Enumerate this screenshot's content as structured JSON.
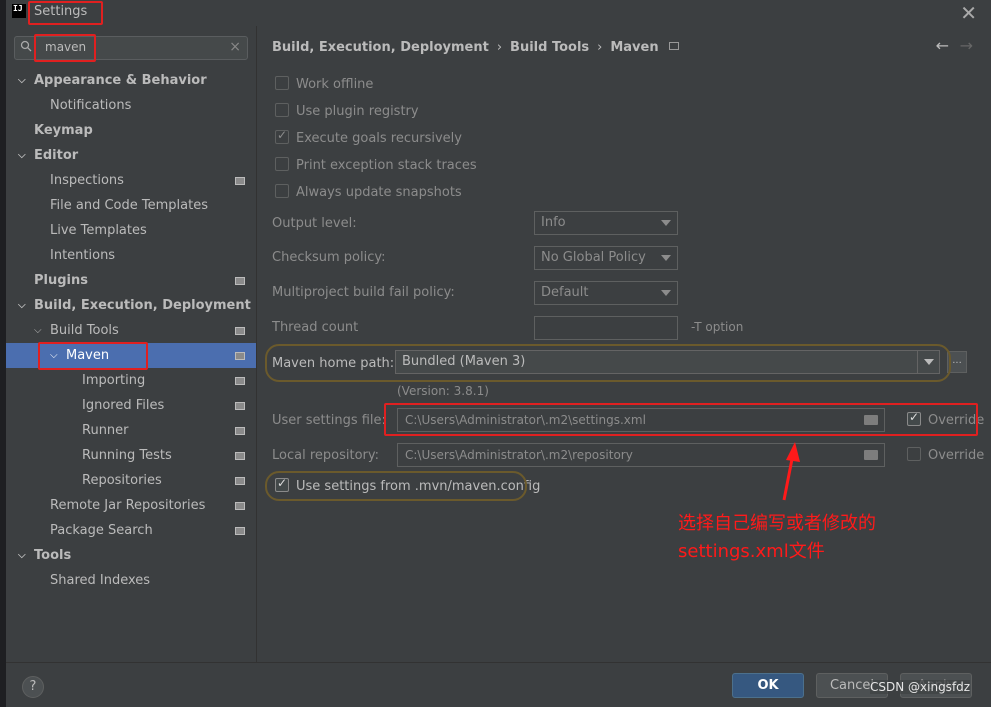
{
  "window": {
    "title": "Settings",
    "logo_text": "IJ"
  },
  "search": {
    "value": "maven"
  },
  "sidebar": {
    "items": [
      {
        "label": "Appearance & Behavior",
        "indent": 0,
        "bold": true,
        "arrow": "down"
      },
      {
        "label": "Notifications",
        "indent": 1,
        "bold": false
      },
      {
        "label": "Keymap",
        "indent": 0,
        "bold": true
      },
      {
        "label": "Editor",
        "indent": 0,
        "bold": true,
        "arrow": "down"
      },
      {
        "label": "Inspections",
        "indent": 1,
        "bold": false,
        "page_icon": true
      },
      {
        "label": "File and Code Templates",
        "indent": 1,
        "bold": false
      },
      {
        "label": "Live Templates",
        "indent": 1,
        "bold": false
      },
      {
        "label": "Intentions",
        "indent": 1,
        "bold": false
      },
      {
        "label": "Plugins",
        "indent": 0,
        "bold": true,
        "page_icon": true
      },
      {
        "label": "Build, Execution, Deployment",
        "indent": 0,
        "bold": true,
        "arrow": "down"
      },
      {
        "label": "Build Tools",
        "indent": 1,
        "bold": false,
        "arrow": "down",
        "page_icon": true
      },
      {
        "label": "Maven",
        "indent": 2,
        "bold": false,
        "arrow": "down",
        "page_icon": true,
        "selected": true
      },
      {
        "label": "Importing",
        "indent": 3,
        "bold": false,
        "page_icon": true
      },
      {
        "label": "Ignored Files",
        "indent": 3,
        "bold": false,
        "page_icon": true
      },
      {
        "label": "Runner",
        "indent": 3,
        "bold": false,
        "page_icon": true
      },
      {
        "label": "Running Tests",
        "indent": 3,
        "bold": false,
        "page_icon": true
      },
      {
        "label": "Repositories",
        "indent": 3,
        "bold": false,
        "page_icon": true
      },
      {
        "label": "Remote Jar Repositories",
        "indent": 1,
        "bold": false,
        "page_icon": true
      },
      {
        "label": "Package Search",
        "indent": 1,
        "bold": false,
        "page_icon": true
      },
      {
        "label": "Tools",
        "indent": 0,
        "bold": true,
        "arrow": "down"
      },
      {
        "label": "Shared Indexes",
        "indent": 1,
        "bold": false
      }
    ]
  },
  "breadcrumb": [
    "Build, Execution, Deployment",
    "Build Tools",
    "Maven"
  ],
  "options": {
    "work_offline": {
      "label": "Work offline",
      "checked": false
    },
    "plugin_registry": {
      "label": "Use plugin registry",
      "checked": false
    },
    "goals_recursive": {
      "label": "Execute goals recursively",
      "checked": true
    },
    "print_exceptions": {
      "label": "Print exception stack traces",
      "checked": false
    },
    "update_snapshots": {
      "label": "Always update snapshots",
      "checked": false
    }
  },
  "fields": {
    "output_level": {
      "label": "Output level:",
      "value": "Info"
    },
    "checksum_policy": {
      "label": "Checksum policy:",
      "value": "No Global Policy"
    },
    "fail_policy": {
      "label": "Multiproject build fail policy:",
      "value": "Default"
    },
    "thread_count": {
      "label": "Thread count",
      "value": "",
      "suffix": "-T option"
    },
    "maven_home": {
      "label": "Maven home path:",
      "value": "Bundled (Maven 3)",
      "button": "...",
      "version": "(Version: 3.8.1)"
    },
    "user_settings": {
      "label": "User settings file:",
      "value": "C:\\Users\\Administrator\\.m2\\settings.xml",
      "override_label": "Override",
      "override": true
    },
    "local_repo": {
      "label": "Local repository:",
      "value": "C:\\Users\\Administrator\\.m2\\repository",
      "override_label": "Override",
      "override": false
    },
    "mvn_config": {
      "label": "Use settings from .mvn/maven.config",
      "checked": true
    }
  },
  "annotation": {
    "line1": "选择自己编写或者修改的",
    "line2": "settings.xml文件"
  },
  "footer": {
    "help": "?",
    "ok": "OK",
    "cancel": "Cancel",
    "apply": "Apply"
  },
  "watermark": "CSDN @xingsfdz",
  "colors": {
    "selection": "#4b6eaf",
    "highlight_red": "#e02020",
    "annotation_red": "#ff1a1a",
    "ok_button": "#365880"
  }
}
